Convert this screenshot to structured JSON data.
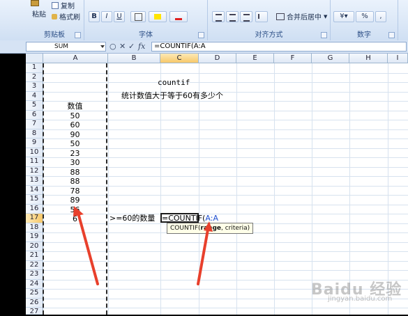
{
  "ribbon": {
    "clipboard": {
      "paste_label": "粘贴",
      "copy_label": "复制",
      "format_painter_label": "格式刷",
      "group_label": "剪贴板"
    },
    "font": {
      "group_label": "字体",
      "bold": "B",
      "italic": "I",
      "underline": "U"
    },
    "alignment": {
      "group_label": "对齐方式",
      "merge_label": "合并后居中"
    },
    "number": {
      "group_label": "数字",
      "percent": "%",
      "comma": ","
    }
  },
  "formula_bar": {
    "name_box": "SUM",
    "cancel": "✕",
    "enter": "✓",
    "fx": "fx",
    "formula": "=COUNTIF(A:A"
  },
  "columns": [
    "A",
    "B",
    "C",
    "D",
    "E",
    "F",
    "G",
    "H",
    "I"
  ],
  "active_column": "C",
  "rows": [
    "1",
    "2",
    "3",
    "4",
    "5",
    "6",
    "7",
    "8",
    "9",
    "10",
    "11",
    "12",
    "13",
    "14",
    "15",
    "16",
    "17",
    "18",
    "19",
    "20",
    "21",
    "22",
    "23",
    "24",
    "25",
    "26",
    "27"
  ],
  "active_row": "17",
  "cells": {
    "title": "countif",
    "description": "统计数值大于等于60有多少个",
    "header_a5": "数值",
    "values": [
      "50",
      "60",
      "90",
      "50",
      "23",
      "30",
      "88",
      "88",
      "78",
      "89",
      "56",
      "6"
    ],
    "label_b17": ">=60的数量",
    "edit_prefix": "=COUNTIF(",
    "edit_range": "A:A"
  },
  "tooltip": {
    "fn": "COUNTIF(",
    "arg1": "range",
    "rest": ", criteria)"
  },
  "watermark": {
    "main": "Baidu 经验",
    "sub": "jingyan.baidu.com"
  },
  "colors": {
    "ribbon_bg": "#dce8f7",
    "header_active": "#f7c86a",
    "range_ref": "#1f4fd0",
    "arrow": "#e8402c"
  }
}
